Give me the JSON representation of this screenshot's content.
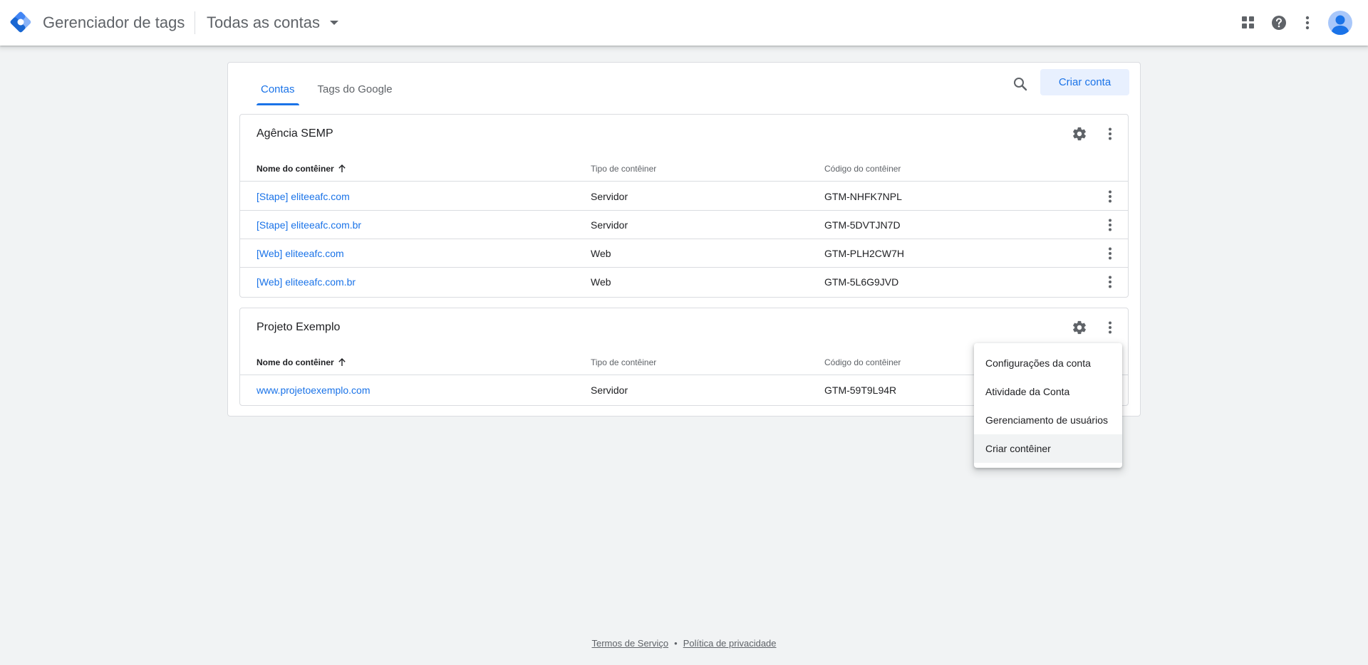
{
  "header": {
    "product_name": "Gerenciador de tags",
    "account_selector": "Todas as contas",
    "icons": [
      "apps-icon",
      "help-icon",
      "more-vert-icon"
    ],
    "brand_color": "#1a73e8"
  },
  "tabs": [
    {
      "label": "Contas",
      "active": true
    },
    {
      "label": "Tags do Google",
      "active": false
    }
  ],
  "create_account_label": "Criar conta",
  "columns": {
    "name": "Nome do contêiner",
    "type": "Tipo de contêiner",
    "code": "Código do contêiner"
  },
  "accounts": [
    {
      "name": "Agência SEMP",
      "containers": [
        {
          "name": "[Stape] eliteeafc.com",
          "type": "Servidor",
          "code": "GTM-NHFK7NPL"
        },
        {
          "name": "[Stape] eliteeafc.com.br",
          "type": "Servidor",
          "code": "GTM-5DVTJN7D"
        },
        {
          "name": "[Web] eliteeafc.com",
          "type": "Web",
          "code": "GTM-PLH2CW7H"
        },
        {
          "name": "[Web] eliteeafc.com.br",
          "type": "Web",
          "code": "GTM-5L6G9JVD"
        }
      ]
    },
    {
      "name": "Projeto Exemplo",
      "containers": [
        {
          "name": "www.projetoexemplo.com",
          "type": "Servidor",
          "code": "GTM-59T9L94R"
        }
      ]
    }
  ],
  "menu": {
    "items": [
      "Configurações da conta",
      "Atividade da Conta",
      "Gerenciamento de usuários",
      "Criar contêiner"
    ],
    "hovered_index": 3
  },
  "footer": {
    "terms": "Termos de Serviço",
    "separator": "•",
    "privacy": "Política de privacidade"
  }
}
